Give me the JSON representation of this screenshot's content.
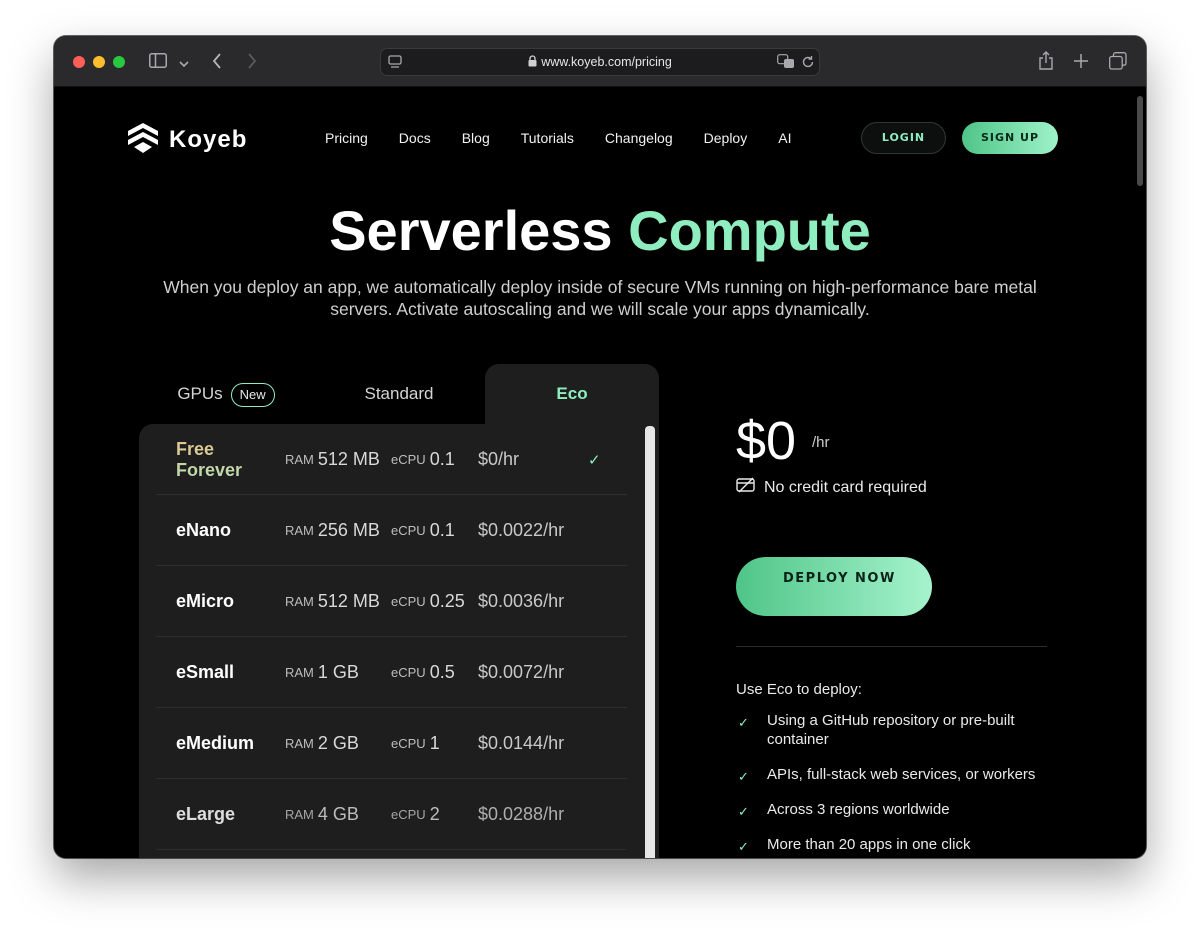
{
  "browser": {
    "url": "www.koyeb.com/pricing",
    "icons": [
      "sidebar-icon",
      "chevron-down-icon",
      "back-icon",
      "forward-icon",
      "reader-icon",
      "lock-icon",
      "translate-icon",
      "reload-icon",
      "share-icon",
      "new-tab-icon",
      "tabs-overview-icon"
    ]
  },
  "header": {
    "logo_text": "Koyeb",
    "nav": [
      "Pricing",
      "Docs",
      "Blog",
      "Tutorials",
      "Changelog",
      "Deploy",
      "AI"
    ],
    "login_label": "LOGIN",
    "signup_label": "SIGN UP"
  },
  "hero": {
    "title_white": "Serverless",
    "title_accent": "Compute",
    "subtitle": "When you deploy an app, we automatically deploy inside of secure VMs running on high-performance bare metal servers. Activate autoscaling and we will scale your apps dynamically."
  },
  "tabs": [
    {
      "label": "GPUs",
      "badge": "New"
    },
    {
      "label": "Standard"
    },
    {
      "label": "Eco",
      "active": true
    }
  ],
  "plans": {
    "ram_label": "RAM",
    "cpu_label": "eCPU",
    "rows": [
      {
        "name": "Free Forever",
        "ram": "512 MB",
        "cpu": "0.1",
        "price": "$0/hr",
        "selected": true
      },
      {
        "name": "eNano",
        "ram": "256 MB",
        "cpu": "0.1",
        "price": "$0.0022/hr"
      },
      {
        "name": "eMicro",
        "ram": "512 MB",
        "cpu": "0.25",
        "price": "$0.0036/hr"
      },
      {
        "name": "eSmall",
        "ram": "1 GB",
        "cpu": "0.5",
        "price": "$0.0072/hr"
      },
      {
        "name": "eMedium",
        "ram": "2 GB",
        "cpu": "1",
        "price": "$0.0144/hr"
      },
      {
        "name": "eLarge",
        "ram": "4 GB",
        "cpu": "2",
        "price": "$0.0288/hr"
      }
    ]
  },
  "summary": {
    "price": "$0",
    "unit": "/hr",
    "no_cc": "No credit card required",
    "deploy_label": "DEPLOY NOW",
    "use_title": "Use Eco to deploy:",
    "use_items": [
      "Using a GitHub repository or pre-built container",
      "APIs, full-stack web services, or workers",
      "Across 3 regions worldwide",
      "More than 20 apps in one click"
    ]
  },
  "colors": {
    "accent": "#8eeec0",
    "button_gradient_start": "#4fc588",
    "button_gradient_end": "#9ff2c9",
    "background": "#000000",
    "panel": "#1e1e1e"
  }
}
